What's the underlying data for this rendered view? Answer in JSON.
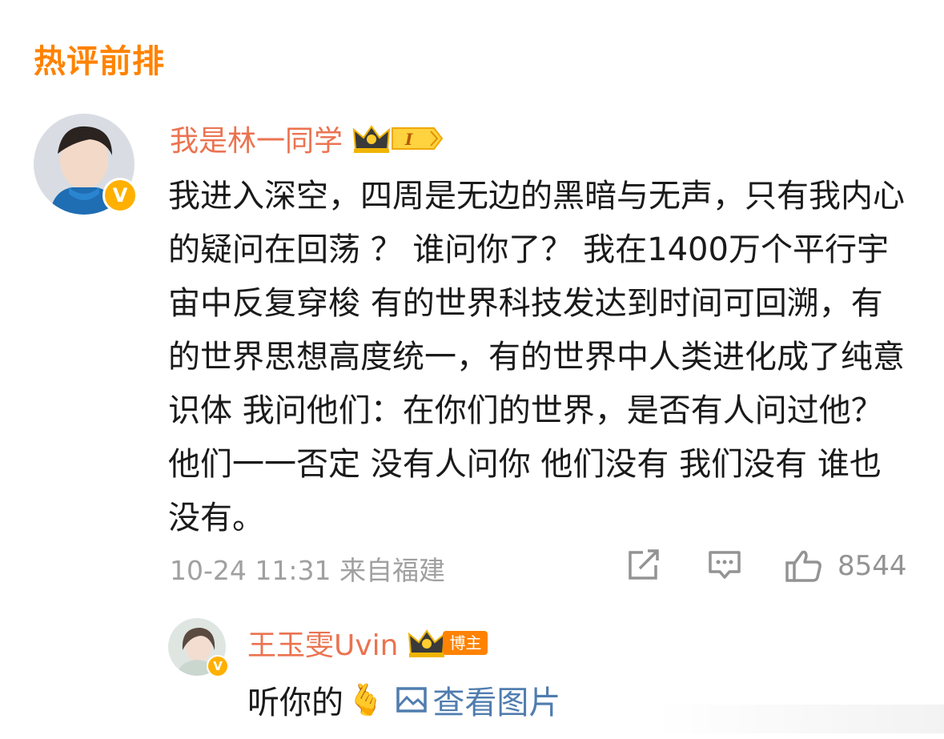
{
  "section": {
    "title": "热评前排"
  },
  "comment": {
    "username": "我是林一同学",
    "level_badge": "I",
    "text": "我进入深空，四周是无边的黑暗与无声，只有我内心的疑问在回荡 ？ 谁问你了？ 我在1400万个平行宇宙中反复穿梭 有的世界科技发达到时间可回溯，有的世界思想高度统一，有的世界中人类进化成了纯意识体 我问他们：在你们的世界，是否有人问过他？ 他们一一否定 没有人问你 他们没有 我们没有 谁也没有。",
    "timestamp": "10-24 11:31",
    "location": "来自福建",
    "like_count": "8544",
    "icons": {
      "share": "share-icon",
      "comment": "comment-icon",
      "like": "thumbs-up-icon"
    }
  },
  "reply": {
    "username": "王玉雯Uvin",
    "tag": "博主",
    "text": "听你的",
    "emoji": "🫰",
    "view_image_label": "查看图片"
  },
  "colors": {
    "accent": "#ff8200",
    "username": "#eb7350",
    "link": "#507daf",
    "meta": "#a0a0a0"
  }
}
